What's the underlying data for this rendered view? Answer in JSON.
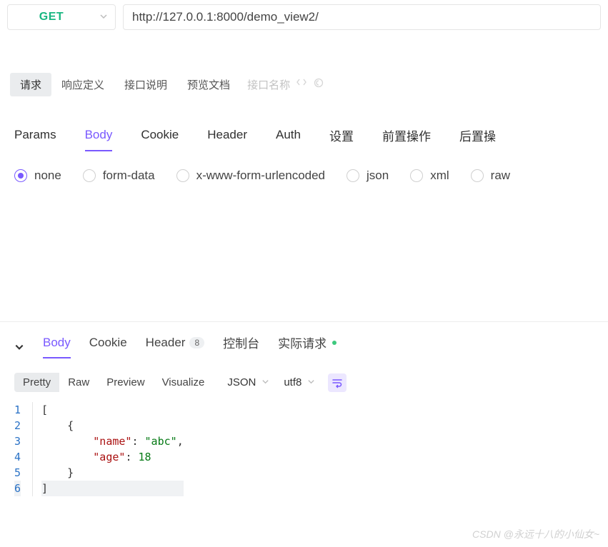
{
  "request": {
    "method": "GET",
    "url": "http://127.0.0.1:8000/demo_view2/"
  },
  "top_tabs": {
    "items": [
      "请求",
      "响应定义",
      "接口说明",
      "预览文档"
    ],
    "active_index": 0,
    "placeholder": "接口名称"
  },
  "section_tabs": {
    "items": [
      "Params",
      "Body",
      "Cookie",
      "Header",
      "Auth",
      "设置",
      "前置操作",
      "后置操"
    ],
    "active_index": 1
  },
  "body_types": {
    "items": [
      "none",
      "form-data",
      "x-www-form-urlencoded",
      "json",
      "xml",
      "raw"
    ],
    "selected_index": 0
  },
  "response_tabs": {
    "items": [
      {
        "label": "Body"
      },
      {
        "label": "Cookie"
      },
      {
        "label": "Header",
        "badge": "8"
      },
      {
        "label": "控制台"
      },
      {
        "label": "实际请求",
        "dot": true
      }
    ],
    "active_index": 0
  },
  "format_bar": {
    "modes": [
      "Pretty",
      "Raw",
      "Preview",
      "Visualize"
    ],
    "active_mode_index": 0,
    "format": "JSON",
    "encoding": "utf8"
  },
  "response_body": {
    "lines": [
      {
        "n": 1,
        "indent": 0,
        "tokens": [
          {
            "t": "bracket",
            "v": "["
          }
        ]
      },
      {
        "n": 2,
        "indent": 1,
        "tokens": [
          {
            "t": "bracket",
            "v": "{"
          }
        ]
      },
      {
        "n": 3,
        "indent": 2,
        "tokens": [
          {
            "t": "key",
            "v": "\"name\""
          },
          {
            "t": "colon",
            "v": ": "
          },
          {
            "t": "string",
            "v": "\"abc\""
          },
          {
            "t": "punct",
            "v": ","
          }
        ]
      },
      {
        "n": 4,
        "indent": 2,
        "tokens": [
          {
            "t": "key",
            "v": "\"age\""
          },
          {
            "t": "colon",
            "v": ": "
          },
          {
            "t": "number",
            "v": "18"
          }
        ]
      },
      {
        "n": 5,
        "indent": 1,
        "tokens": [
          {
            "t": "bracket",
            "v": "}"
          }
        ]
      },
      {
        "n": 6,
        "indent": 0,
        "tokens": [
          {
            "t": "bracket",
            "v": "]"
          }
        ],
        "active": true
      }
    ]
  },
  "watermark": "CSDN @永远十八的小仙女~"
}
